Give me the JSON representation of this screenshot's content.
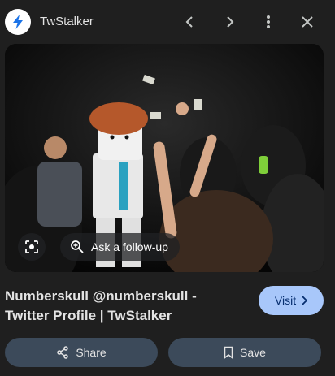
{
  "header": {
    "site_name": "TwStalker",
    "icons": [
      "lightning-logo-icon",
      "chevron-left-icon",
      "chevron-right-icon",
      "more-vert-icon",
      "close-icon"
    ]
  },
  "image": {
    "description_icons": [
      "google-lens-icon",
      "search-plus-icon"
    ],
    "follow_up_label": "Ask a follow-up"
  },
  "result": {
    "title": "Numberskull @numberskull - Twitter Profile | TwStalker",
    "visit_label": "Visit"
  },
  "actions": {
    "share_label": "Share",
    "save_label": "Save"
  },
  "colors": {
    "background": "#1f1f1f",
    "visit_button": "#a8c7fa",
    "action_button": "#3c4a5a",
    "logo_accent": "#1a73e8"
  }
}
